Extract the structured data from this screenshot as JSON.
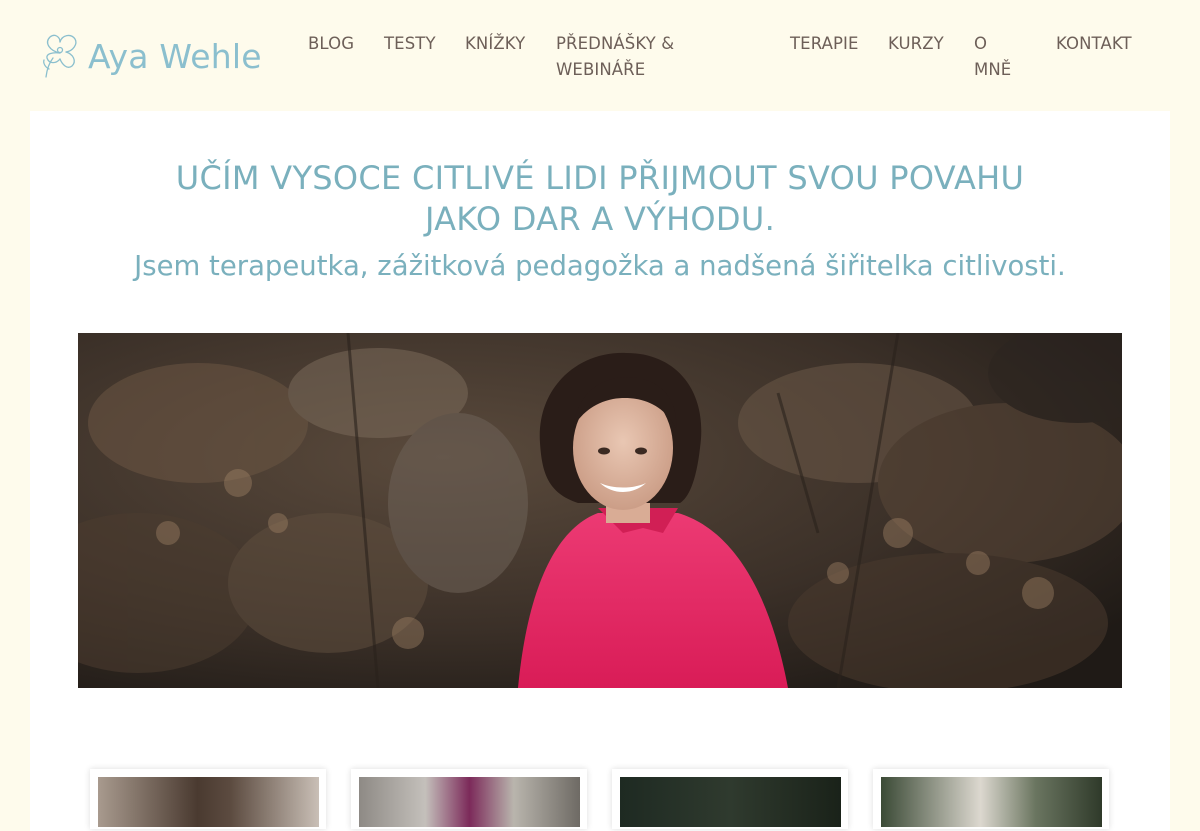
{
  "logo": {
    "text": "Aya Wehle"
  },
  "nav": {
    "blog": "BLOG",
    "testy": "TESTY",
    "knizky": "KNÍŽKY",
    "prednasky_line1": "PŘEDNÁŠKY &",
    "prednasky_line2": "WEBINÁŘE",
    "terapie": "TERAPIE",
    "kurzy": "KURZY",
    "o_mne_line1": "O",
    "o_mne_line2": "MNĚ",
    "kontakt": "KONTAKT"
  },
  "hero": {
    "headline_line1": "UČÍM VYSOCE CITLIVÉ LIDI PŘIJMOUT SVOU POVAHU",
    "headline_line2": "JAKO DAR A VÝHODU.",
    "subheadline": "Jsem terapeutka, zážitková pedagožka a nadšená šiřitelka citlivosti."
  },
  "colors": {
    "page_bg": "#fefbec",
    "accent": "#7ab0bd",
    "logo": "#8bbfce",
    "nav_text": "#6d5f58",
    "shirt": "#e6245f"
  },
  "icons": {
    "logo": "poppy-flower-icon"
  }
}
